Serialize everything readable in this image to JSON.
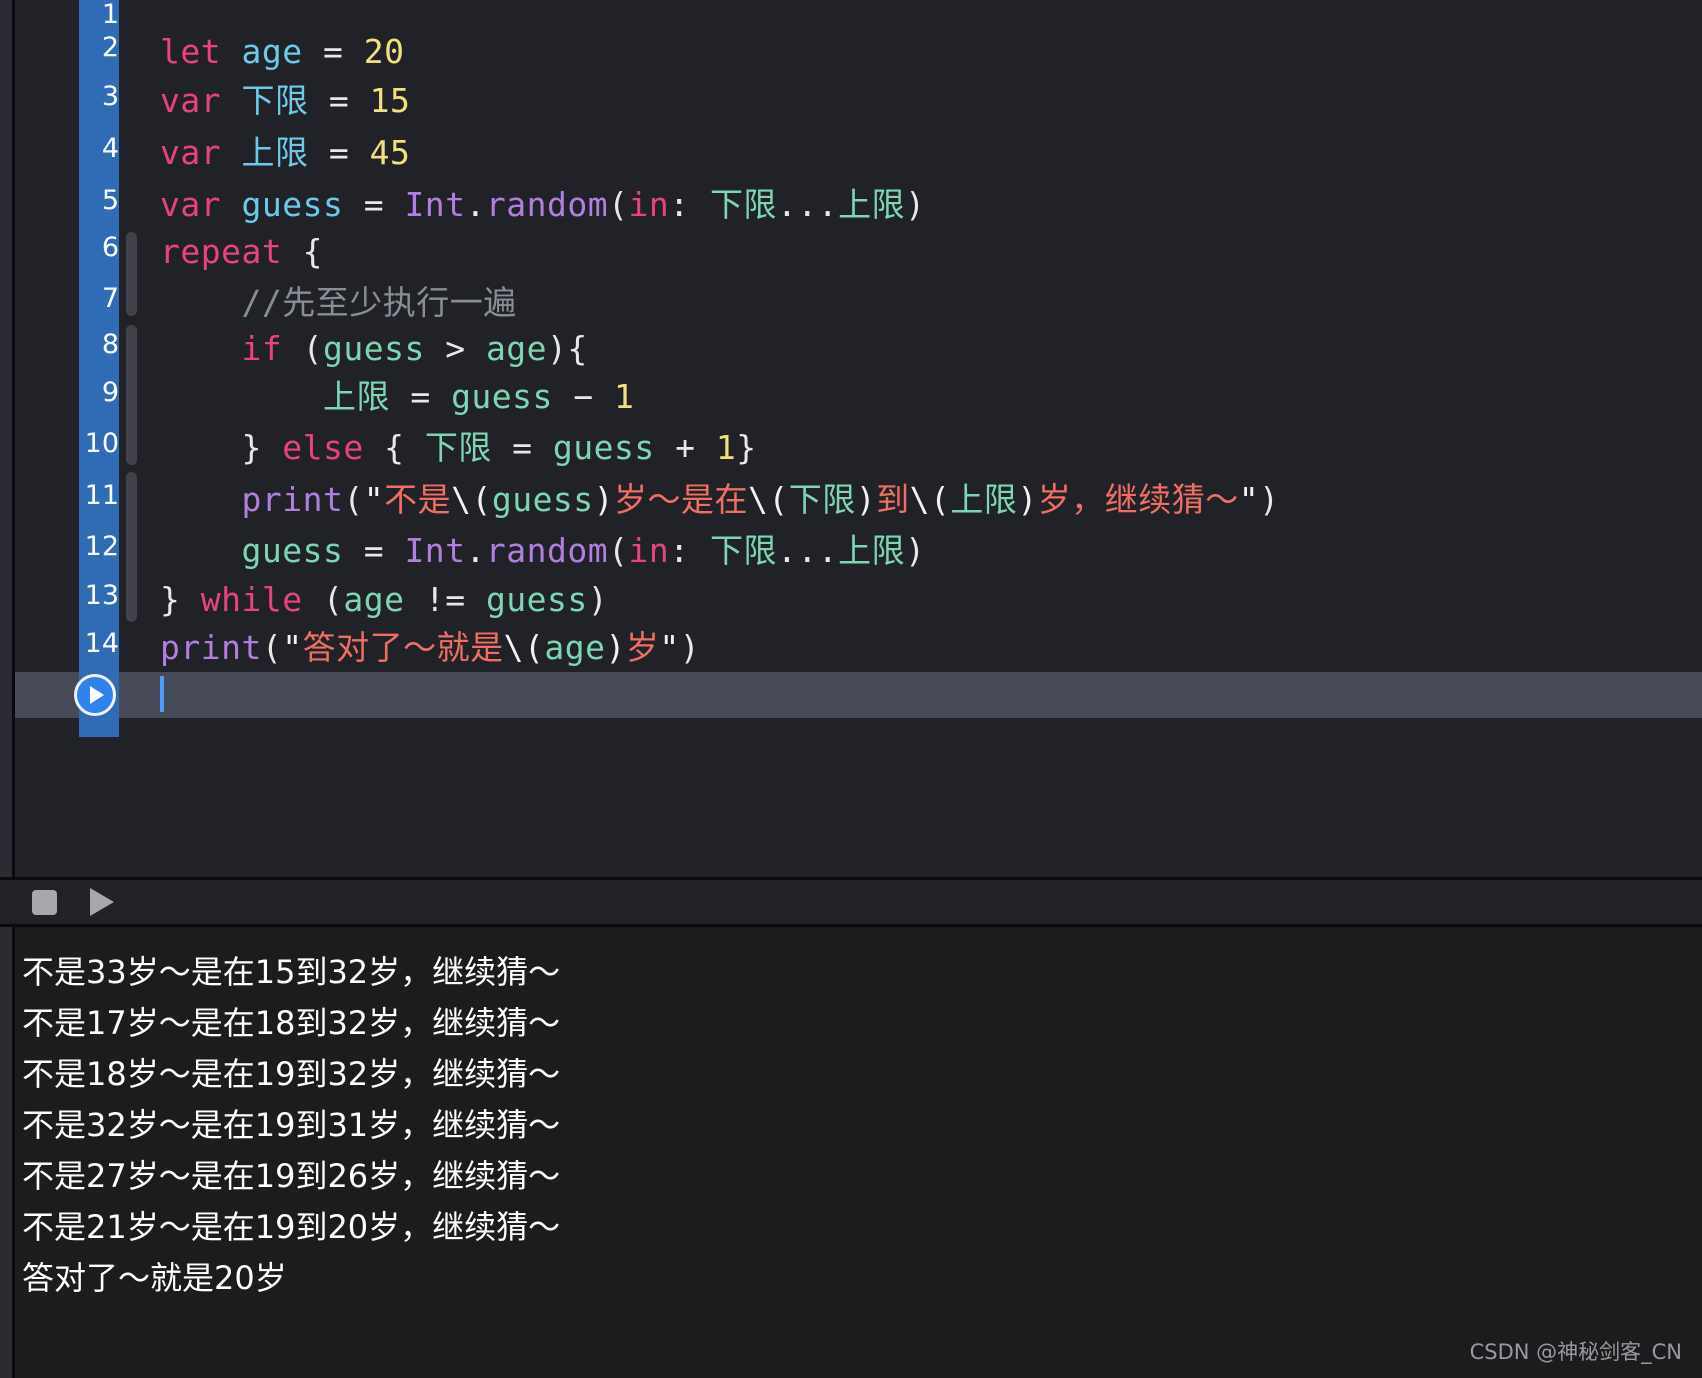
{
  "editor": {
    "language": "Swift",
    "background_color": "#212227",
    "gutter_color": "#2f6cb5",
    "active_line_color": "#474a57",
    "caret_color": "#4a9eff",
    "line_numbers": [
      "1",
      "2",
      "3",
      "4",
      "5",
      "6",
      "7",
      "8",
      "9",
      "10",
      "11",
      "12",
      "13",
      "14"
    ],
    "lines": [
      {
        "n": "1",
        "tokens": []
      },
      {
        "n": "2",
        "tokens": [
          {
            "t": "let ",
            "c": "kw"
          },
          {
            "t": "age",
            "c": "idn"
          },
          {
            "t": " = ",
            "c": "pun"
          },
          {
            "t": "20",
            "c": "num"
          }
        ]
      },
      {
        "n": "3",
        "tokens": [
          {
            "t": "var ",
            "c": "kw"
          },
          {
            "t": "下限",
            "c": "idn"
          },
          {
            "t": " = ",
            "c": "pun"
          },
          {
            "t": "15",
            "c": "num"
          }
        ]
      },
      {
        "n": "4",
        "tokens": [
          {
            "t": "var ",
            "c": "kw"
          },
          {
            "t": "上限",
            "c": "idn"
          },
          {
            "t": " = ",
            "c": "pun"
          },
          {
            "t": "45",
            "c": "num"
          }
        ]
      },
      {
        "n": "5",
        "tokens": [
          {
            "t": "var ",
            "c": "kw"
          },
          {
            "t": "guess",
            "c": "idn"
          },
          {
            "t": " = ",
            "c": "pun"
          },
          {
            "t": "Int",
            "c": "fn"
          },
          {
            "t": ".",
            "c": "pun"
          },
          {
            "t": "random",
            "c": "fn"
          },
          {
            "t": "(",
            "c": "pun"
          },
          {
            "t": "in",
            "c": "kw"
          },
          {
            "t": ": ",
            "c": "pun"
          },
          {
            "t": "下限",
            "c": "grn"
          },
          {
            "t": "...",
            "c": "pun"
          },
          {
            "t": "上限",
            "c": "grn"
          },
          {
            "t": ")",
            "c": "pun"
          }
        ]
      },
      {
        "n": "6",
        "tokens": [
          {
            "t": "repeat",
            "c": "kw"
          },
          {
            "t": " {",
            "c": "pun"
          }
        ]
      },
      {
        "n": "7",
        "tokens": [
          {
            "t": "    //先至少执行一遍",
            "c": "cmt"
          }
        ]
      },
      {
        "n": "8",
        "tokens": [
          {
            "t": "    ",
            "c": "pun"
          },
          {
            "t": "if",
            "c": "kw"
          },
          {
            "t": " (",
            "c": "pun"
          },
          {
            "t": "guess",
            "c": "grn"
          },
          {
            "t": " > ",
            "c": "pun"
          },
          {
            "t": "age",
            "c": "grn"
          },
          {
            "t": "){",
            "c": "pun"
          }
        ]
      },
      {
        "n": "9",
        "tokens": [
          {
            "t": "        ",
            "c": "pun"
          },
          {
            "t": "上限",
            "c": "grn"
          },
          {
            "t": " = ",
            "c": "pun"
          },
          {
            "t": "guess",
            "c": "grn"
          },
          {
            "t": " − ",
            "c": "pun"
          },
          {
            "t": "1",
            "c": "num"
          }
        ]
      },
      {
        "n": "10",
        "tokens": [
          {
            "t": "    } ",
            "c": "pun"
          },
          {
            "t": "else",
            "c": "kw"
          },
          {
            "t": " { ",
            "c": "pun"
          },
          {
            "t": "下限",
            "c": "grn"
          },
          {
            "t": " = ",
            "c": "pun"
          },
          {
            "t": "guess",
            "c": "grn"
          },
          {
            "t": " + ",
            "c": "pun"
          },
          {
            "t": "1",
            "c": "num"
          },
          {
            "t": "}",
            "c": "pun"
          }
        ]
      },
      {
        "n": "11",
        "tokens": [
          {
            "t": "    ",
            "c": "pun"
          },
          {
            "t": "print",
            "c": "fn"
          },
          {
            "t": "(",
            "c": "pun"
          },
          {
            "t": "\"",
            "c": "wht"
          },
          {
            "t": "不是",
            "c": "str"
          },
          {
            "t": "\\(",
            "c": "wht"
          },
          {
            "t": "guess",
            "c": "grn"
          },
          {
            "t": ")",
            "c": "wht"
          },
          {
            "t": "岁〜是在",
            "c": "str"
          },
          {
            "t": "\\(",
            "c": "wht"
          },
          {
            "t": "下限",
            "c": "grn"
          },
          {
            "t": ")",
            "c": "wht"
          },
          {
            "t": "到",
            "c": "str"
          },
          {
            "t": "\\(",
            "c": "wht"
          },
          {
            "t": "上限",
            "c": "grn"
          },
          {
            "t": ")",
            "c": "wht"
          },
          {
            "t": "岁，继续猜〜",
            "c": "str"
          },
          {
            "t": "\"",
            "c": "wht"
          },
          {
            "t": ")",
            "c": "pun"
          }
        ]
      },
      {
        "n": "12",
        "tokens": [
          {
            "t": "    ",
            "c": "pun"
          },
          {
            "t": "guess",
            "c": "grn"
          },
          {
            "t": " = ",
            "c": "pun"
          },
          {
            "t": "Int",
            "c": "fn"
          },
          {
            "t": ".",
            "c": "pun"
          },
          {
            "t": "random",
            "c": "fn"
          },
          {
            "t": "(",
            "c": "pun"
          },
          {
            "t": "in",
            "c": "kw"
          },
          {
            "t": ": ",
            "c": "pun"
          },
          {
            "t": "下限",
            "c": "grn"
          },
          {
            "t": "...",
            "c": "pun"
          },
          {
            "t": "上限",
            "c": "grn"
          },
          {
            "t": ")",
            "c": "pun"
          }
        ]
      },
      {
        "n": "13",
        "tokens": [
          {
            "t": "} ",
            "c": "pun"
          },
          {
            "t": "while",
            "c": "kw"
          },
          {
            "t": " (",
            "c": "pun"
          },
          {
            "t": "age",
            "c": "grn"
          },
          {
            "t": " != ",
            "c": "pun"
          },
          {
            "t": "guess",
            "c": "grn"
          },
          {
            "t": ")",
            "c": "pun"
          }
        ]
      },
      {
        "n": "14",
        "tokens": [
          {
            "t": "print",
            "c": "fn"
          },
          {
            "t": "(",
            "c": "pun"
          },
          {
            "t": "\"",
            "c": "wht"
          },
          {
            "t": "答对了〜就是",
            "c": "str"
          },
          {
            "t": "\\(",
            "c": "wht"
          },
          {
            "t": "age",
            "c": "grn"
          },
          {
            "t": ")",
            "c": "wht"
          },
          {
            "t": "岁",
            "c": "str"
          },
          {
            "t": "\"",
            "c": "wht"
          },
          {
            "t": ")",
            "c": "pun"
          }
        ]
      }
    ],
    "run_button": {
      "icon": "play-icon",
      "label": ""
    }
  },
  "console": {
    "toolbar": {
      "stop_icon": "stop-square-icon",
      "play_icon": "play-triangle-icon"
    },
    "output": [
      "不是33岁〜是在15到32岁，继续猜〜",
      "不是17岁〜是在18到32岁，继续猜〜",
      "不是18岁〜是在19到32岁，继续猜〜",
      "不是32岁〜是在19到31岁，继续猜〜",
      "不是27岁〜是在19到26岁，继续猜〜",
      "不是21岁〜是在19到20岁，继续猜〜",
      "答对了〜就是20岁"
    ]
  },
  "watermark": {
    "text": "CSDN @神秘剑客_CN"
  }
}
